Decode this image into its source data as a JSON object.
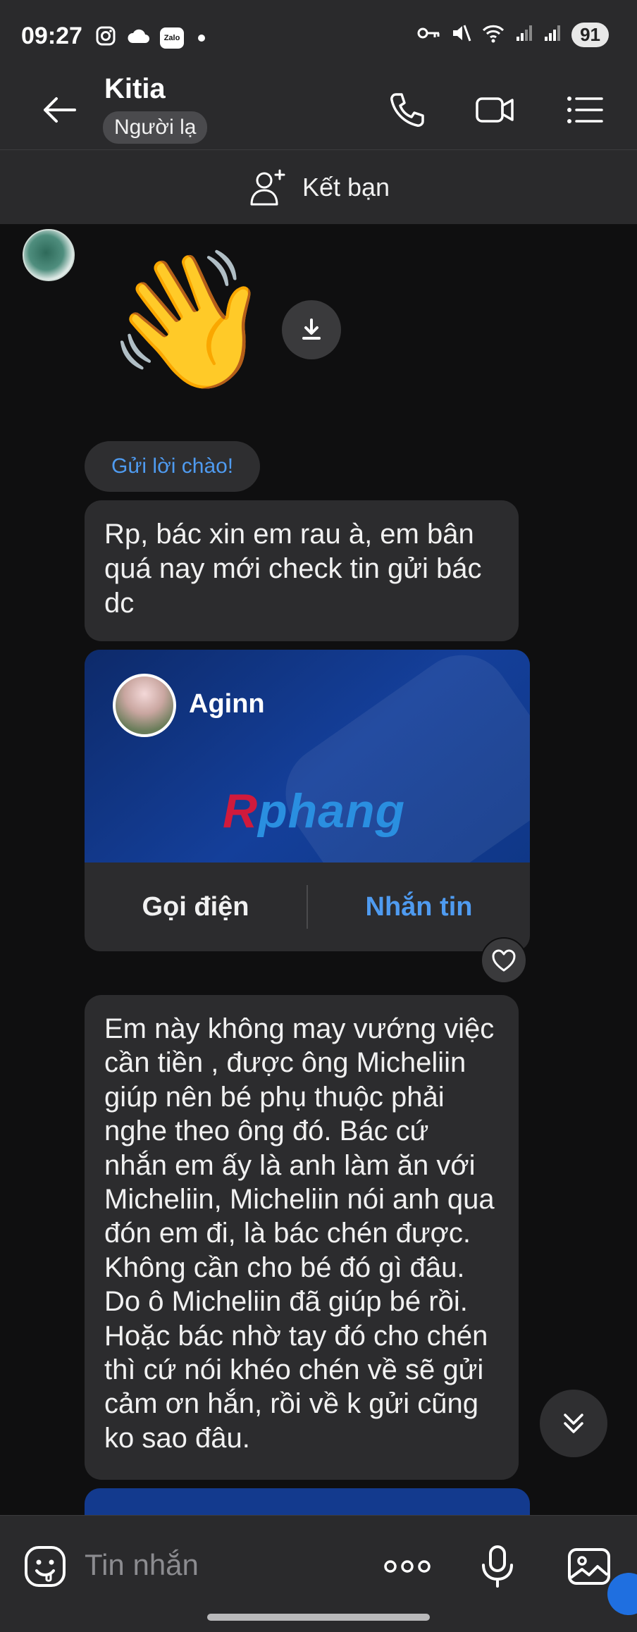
{
  "status_bar": {
    "time": "09:27",
    "zalo_label": "Zalo",
    "battery": "91"
  },
  "header": {
    "contact_name": "Kitia",
    "badge": "Người lạ"
  },
  "add_friend": {
    "label": "Kết bạn"
  },
  "messages": {
    "greet_chip": "Gửi lời chào!",
    "bubble1": "Rp, bác xin em rau à, em bân quá nay mới check tin gửi bác dc",
    "card": {
      "name": "Aginn",
      "logo_first": "R",
      "logo_rest": "phang",
      "call_label": "Gọi điện",
      "message_label": "Nhắn tin"
    },
    "bubble2": "Em này không may vướng việc cần tiền , được ông Micheliin giúp nên bé phụ thuộc phải nghe theo ông đó. Bác cứ nhắn em ấy là anh làm ăn với Micheliin, Micheliin nói anh qua đón em đi, là bác chén được. Không cần cho bé đó gì đâu. Do ô Micheliin đã giúp bé rồi. Hoặc bác nhờ tay đó cho chén thì cứ nói khéo chén về sẽ gửi cảm ơn hắn, rồi về k gửi cũng ko sao đâu."
  },
  "input": {
    "placeholder": "Tin nhắn"
  },
  "icons": {
    "back": "back-arrow-icon",
    "call": "phone-icon",
    "video": "video-camera-icon",
    "menu": "menu-icon",
    "add_friend": "add-user-icon",
    "download": "download-icon",
    "heart": "heart-icon",
    "scroll_down": "chevron-double-down-icon",
    "sticker": "sticker-icon",
    "more": "more-dots-icon",
    "mic": "microphone-icon",
    "image": "image-icon"
  },
  "colors": {
    "accent_blue": "#4f9bf0",
    "background": "#0f0f10",
    "bubble": "#2c2c2e",
    "bar": "#2a2a2c"
  }
}
